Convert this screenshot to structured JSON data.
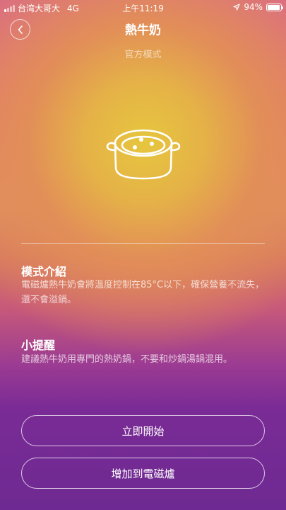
{
  "status_bar": {
    "carrier": "台湾大哥大",
    "network": "4G",
    "time": "上午11:19",
    "battery_percent_label": "94%",
    "battery_level": 0.94,
    "signal_bars_on": 1,
    "signal_bars_total": 4
  },
  "header": {
    "title": "熱牛奶",
    "subtitle": "官方模式"
  },
  "intro": {
    "heading": "模式介紹",
    "body": "電磁爐熱牛奶會將溫度控制在85°C以下，確保營養不流失，還不會溢鍋。"
  },
  "tips": {
    "heading": "小提醒",
    "body": "建議熱牛奶用專門的熱奶鍋，不要和炒鍋湯鍋混用。"
  },
  "actions": {
    "start_label": "立即開始",
    "add_label": "增加到電磁爐"
  },
  "icons": {
    "back": "chevron-left-icon",
    "hero": "pot-icon",
    "location": "location-arrow-icon",
    "battery": "battery-icon",
    "signal": "signal-icon"
  },
  "colors": {
    "glow_center": "#e6c63e",
    "top": "#d96a86",
    "bottom": "#6e2a92"
  }
}
